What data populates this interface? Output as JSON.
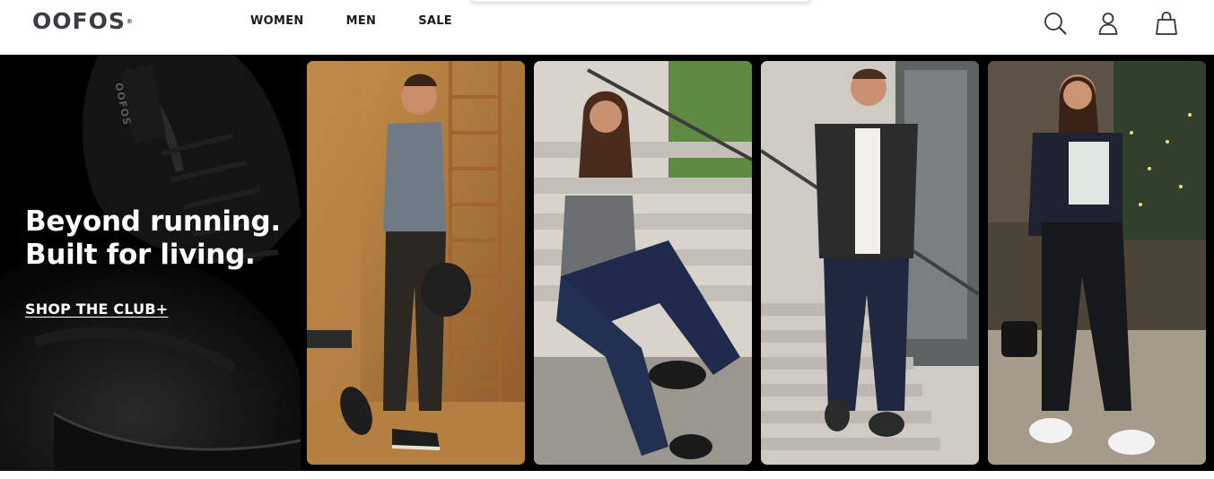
{
  "header": {
    "logo_text": "OOFOS",
    "logo_mark": "®",
    "nav": [
      {
        "label": "WOMEN"
      },
      {
        "label": "MEN"
      },
      {
        "label": "SALE"
      }
    ],
    "icons": [
      "search-icon",
      "account-icon",
      "cart-bag-icon"
    ]
  },
  "hero": {
    "headline_line1": "Beyond running.",
    "headline_line2": "Built for living.",
    "cta_label": "SHOP THE CLUB+",
    "shoe_brand_text": "OOFOS",
    "panels": [
      "man-in-gym-photo",
      "woman-on-stairs-photo",
      "man-on-stairs-photo",
      "woman-on-street-photo"
    ]
  },
  "colors": {
    "text_dark": "#1b1b1b",
    "logo": "#3a3d42",
    "hero_bg": "#000000",
    "hero_text": "#ffffff"
  }
}
